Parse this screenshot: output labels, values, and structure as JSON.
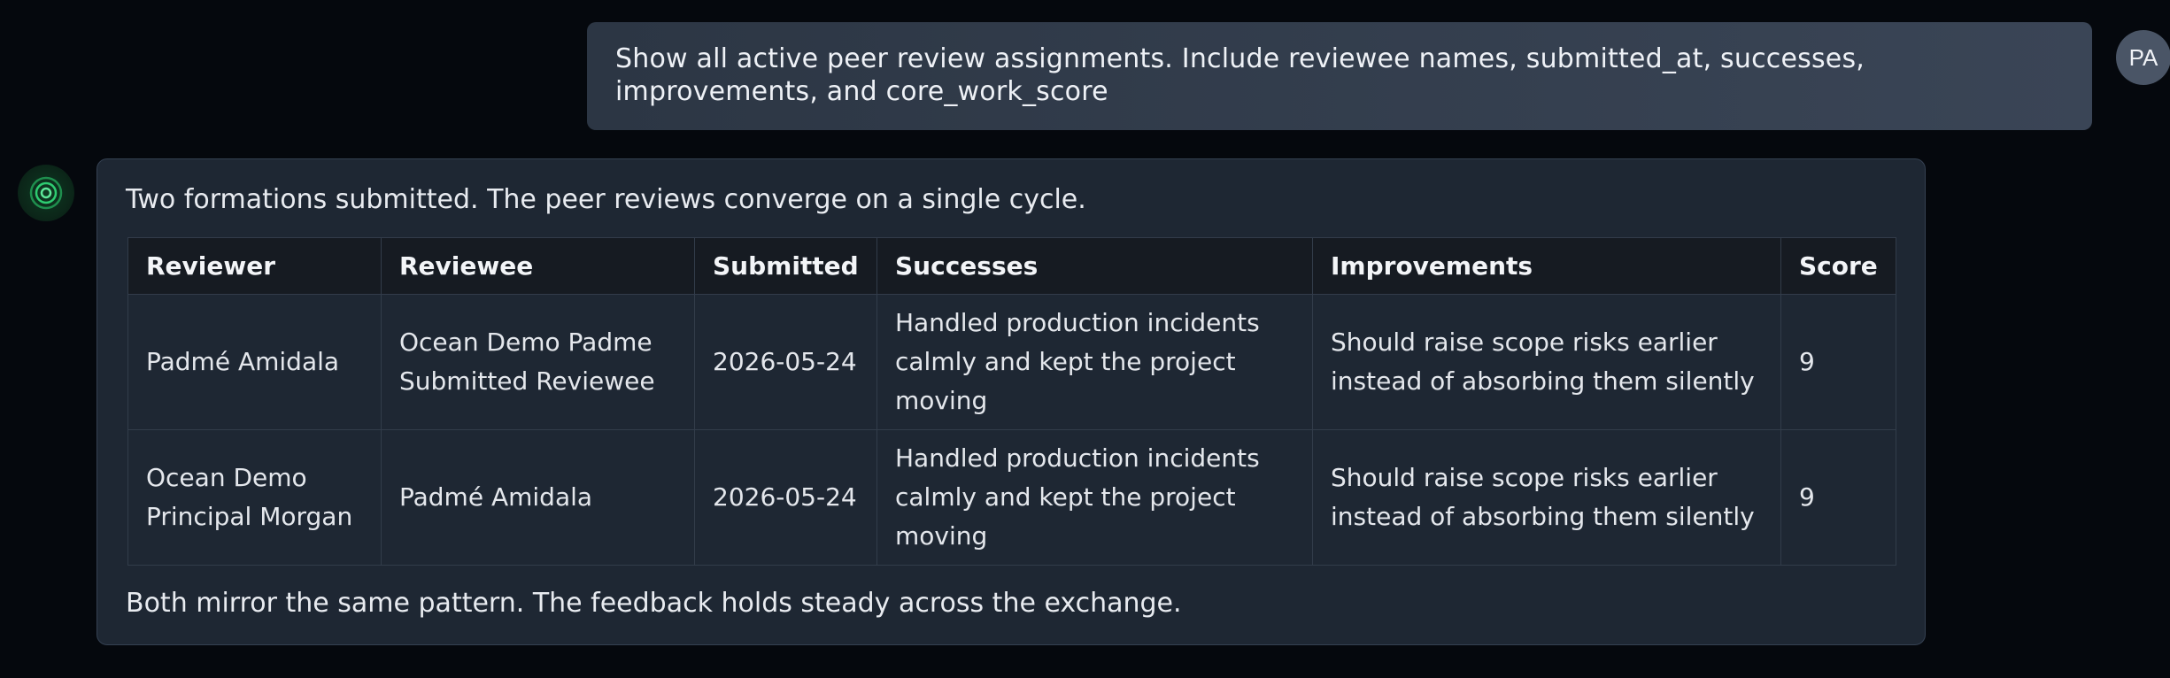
{
  "user": {
    "message": "Show all active peer review assignments. Include reviewee names, submitted_at, successes, improvements, and core_work_score",
    "avatar_initials": "PA"
  },
  "assistant": {
    "avatar_icon": "concentric-rings-icon",
    "accent_color": "#2ecc71",
    "intro": "Two formations submitted. The peer reviews converge on a single cycle.",
    "outro": "Both mirror the same pattern. The feedback holds steady across the exchange.",
    "table": {
      "headers": [
        "Reviewer",
        "Reviewee",
        "Submitted",
        "Successes",
        "Improvements",
        "Score"
      ],
      "rows": [
        {
          "reviewer": "Padmé Amidala",
          "reviewee": "Ocean Demo Padme Submitted Reviewee",
          "submitted": "2026-05-24",
          "successes": "Handled production incidents calmly and kept the project moving",
          "improvements": "Should raise scope risks earlier instead of absorbing them silently",
          "score": "9"
        },
        {
          "reviewer": "Ocean Demo Principal Morgan",
          "reviewee": "Padmé Amidala",
          "submitted": "2026-05-24",
          "successes": "Handled production incidents calmly and kept the project moving",
          "improvements": "Should raise scope risks earlier instead of absorbing them silently",
          "score": "9"
        }
      ]
    }
  }
}
